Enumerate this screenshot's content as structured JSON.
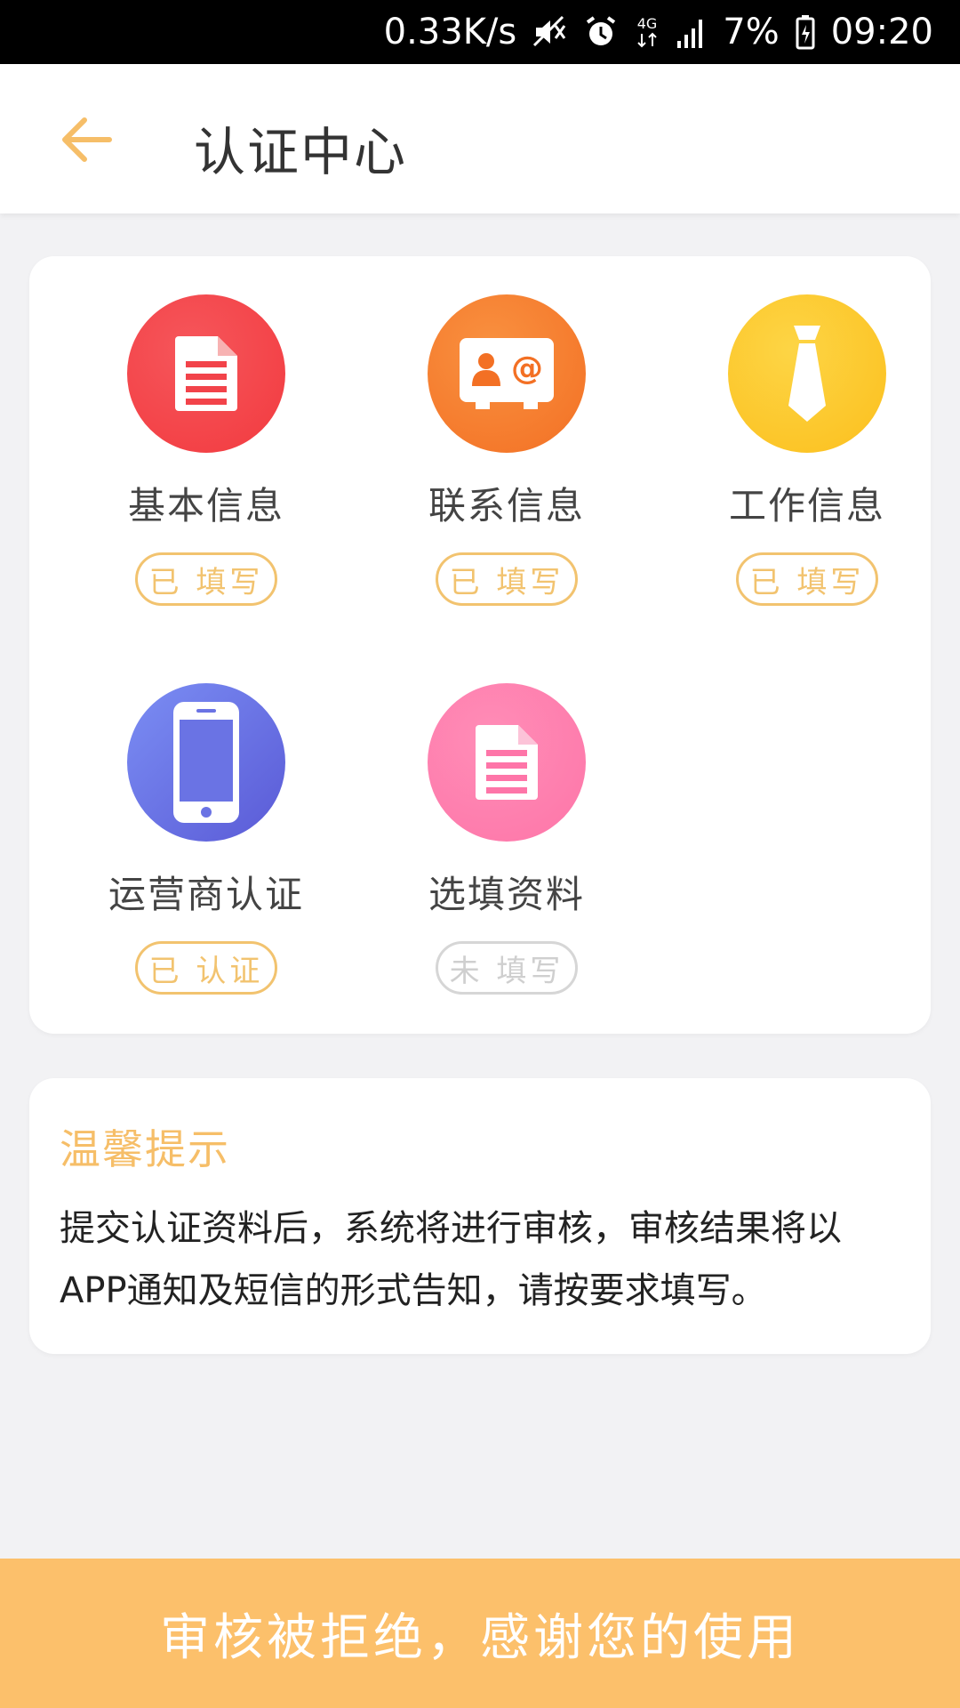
{
  "status_bar": {
    "speed": "0.33K/s",
    "network": "4G",
    "battery": "7%",
    "time": "09:20",
    "icons": [
      "mute-icon",
      "alarm-icon",
      "network-4g-icon",
      "signal-icon",
      "battery-icon"
    ]
  },
  "header": {
    "title": "认证中心",
    "back_icon": "back-arrow-icon",
    "accent": "#f6be68"
  },
  "items": [
    {
      "label": "基本信息",
      "status": "已 填写",
      "icon": "document-icon",
      "color": "#f24a4a"
    },
    {
      "label": "联系信息",
      "status": "已 填写",
      "icon": "contact-card-icon",
      "color": "#f57f2e"
    },
    {
      "label": "工作信息",
      "status": "已 填写",
      "icon": "tie-icon",
      "color": "#fdc72c"
    },
    {
      "label": "运营商认证",
      "status": "已 认证",
      "icon": "phone-icon",
      "color": "#6a78e6"
    },
    {
      "label": "选填资料",
      "status": "未 填写",
      "icon": "document-icon",
      "color": "#fe84ae"
    }
  ],
  "tips": {
    "title": "温馨提示",
    "text": "提交认证资料后，系统将进行审核，审核结果将以APP通知及短信的形式告知，请按要求填写。"
  },
  "bottom_button": {
    "label": "审核被拒绝，感谢您的使用",
    "color": "#fcc06b"
  }
}
